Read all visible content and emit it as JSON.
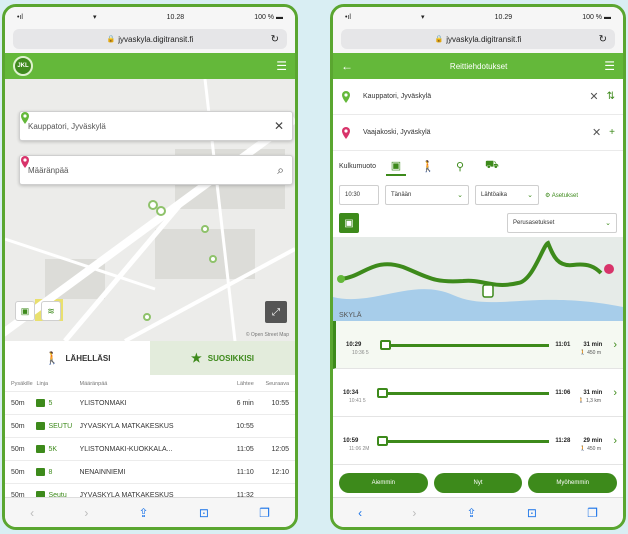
{
  "left": {
    "status": {
      "signal": "•ıl",
      "wifi": "▾",
      "time": "10.28",
      "battery": "100 % ▬"
    },
    "url": "jyvaskyla.digitransit.fi",
    "app": {
      "logo_text": "JKL"
    },
    "from_value": "Kauppatori, Jyväskylä",
    "to_placeholder": "Määränpää",
    "attribution": "© Open Street Map",
    "tabs": {
      "nearby": "LÄHELLÄSI",
      "favorites": "SUOSIKKISI"
    },
    "headers": {
      "dist": "Pysäkille",
      "line": "Linja",
      "dest": "Määränpää",
      "t1": "Lähtee",
      "t2": "Seuraava"
    },
    "departures": [
      {
        "dist": "50m",
        "line": "5",
        "dest": "YLISTÖNMÄKI",
        "t1": "6 min",
        "t2": "10:55"
      },
      {
        "dist": "50m",
        "line": "SEUTU",
        "dest": "JYVÄSKYLÄ MATKAKESKUS",
        "t1": "10:55",
        "t2": ""
      },
      {
        "dist": "50m",
        "line": "5K",
        "dest": "YLISTÖNMÄKI-KUOKKALA...",
        "t1": "11:05",
        "t2": "12:05"
      },
      {
        "dist": "50m",
        "line": "8",
        "dest": "NENAINNIEMI",
        "t1": "11:10",
        "t2": "12:10"
      },
      {
        "dist": "50m",
        "line": "Seutu",
        "dest": "JYVÄSKYLÄ MATKAKESKUS",
        "t1": "11:32",
        "t2": ""
      }
    ]
  },
  "right": {
    "status": {
      "signal": "•ıl",
      "wifi": "▾",
      "time": "10.29",
      "battery": "100 % ▬"
    },
    "url": "jyvaskyla.digitransit.fi",
    "app": {
      "title": "Reittiehdotukset"
    },
    "from_value": "Kauppatori, Jyväskylä",
    "to_value": "Vaajakoski, Jyväskylä",
    "mode_label": "Kulkumuoto",
    "time_value": "10:30",
    "day_value": "Tänään",
    "depart_value": "Lähtöaika",
    "filter_label": "Asetukset",
    "preset_value": "Perusasetukset",
    "map_label": "SKYLÄ",
    "itineraries": [
      {
        "dep": "10:29",
        "arr": "11:01",
        "dur": "31 min",
        "sub": "10:36  5",
        "dist": "🚶 450 m"
      },
      {
        "dep": "10:34",
        "arr": "11:06",
        "dur": "31 min",
        "sub": "10:41  5",
        "dist": "🚶 1,3 km"
      },
      {
        "dep": "10:59",
        "arr": "11:28",
        "dur": "29 min",
        "sub": "11:06  2M",
        "dist": "🚶 450 m"
      }
    ],
    "buttons": {
      "earlier": "Aiemmin",
      "now": "Nyt",
      "later": "Myöhemmin"
    }
  }
}
